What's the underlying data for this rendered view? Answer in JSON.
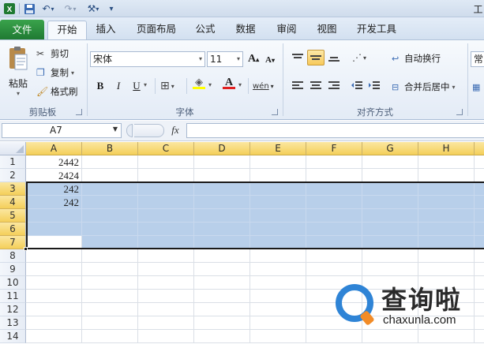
{
  "qat": {
    "title_fragment": "工",
    "icons": [
      "excel-app-icon",
      "save-icon",
      "undo-icon",
      "redo-icon",
      "customize-icon"
    ]
  },
  "tabs": [
    {
      "label": "文件",
      "type": "file"
    },
    {
      "label": "开始",
      "type": "active"
    },
    {
      "label": "插入"
    },
    {
      "label": "页面布局"
    },
    {
      "label": "公式"
    },
    {
      "label": "数据"
    },
    {
      "label": "审阅"
    },
    {
      "label": "视图"
    },
    {
      "label": "开发工具"
    }
  ],
  "ribbon": {
    "clipboard": {
      "group_label": "剪贴板",
      "paste": "粘贴",
      "cut": "剪切",
      "copy": "复制",
      "format_painter": "格式刷"
    },
    "font": {
      "group_label": "字体",
      "font_name": "宋体",
      "font_size": "11",
      "bold": "B",
      "italic": "I",
      "underline": "U",
      "grow": "A",
      "shrink": "A",
      "font_color_label": "A",
      "phonetic": "wén"
    },
    "alignment": {
      "group_label": "对齐方式",
      "wrap_text": "自动换行",
      "merge_center": "合并后居中"
    },
    "number": {
      "format_fragment": "常"
    }
  },
  "formula_bar": {
    "name_box": "A7",
    "fx": "fx",
    "formula": ""
  },
  "sheet": {
    "columns": [
      "A",
      "B",
      "C",
      "D",
      "E",
      "F",
      "G",
      "H"
    ],
    "rows": [
      "1",
      "2",
      "3",
      "4",
      "5",
      "6",
      "7",
      "8",
      "9",
      "10",
      "11",
      "12",
      "13",
      "14"
    ],
    "cells": {
      "A1": "2442",
      "A2": "2424",
      "A3": "242",
      "A4": "242"
    },
    "active_cell": "A7",
    "selected_rows": [
      "3",
      "4",
      "5",
      "6",
      "7"
    ]
  },
  "watermark": {
    "title": "查询啦",
    "url": "chaxunla.com"
  },
  "colors": {
    "file_tab": "#1f7a32",
    "header_selected": "#f4cf5a",
    "selection": "#b8cfea",
    "watermark_blue": "#2f84d6"
  }
}
